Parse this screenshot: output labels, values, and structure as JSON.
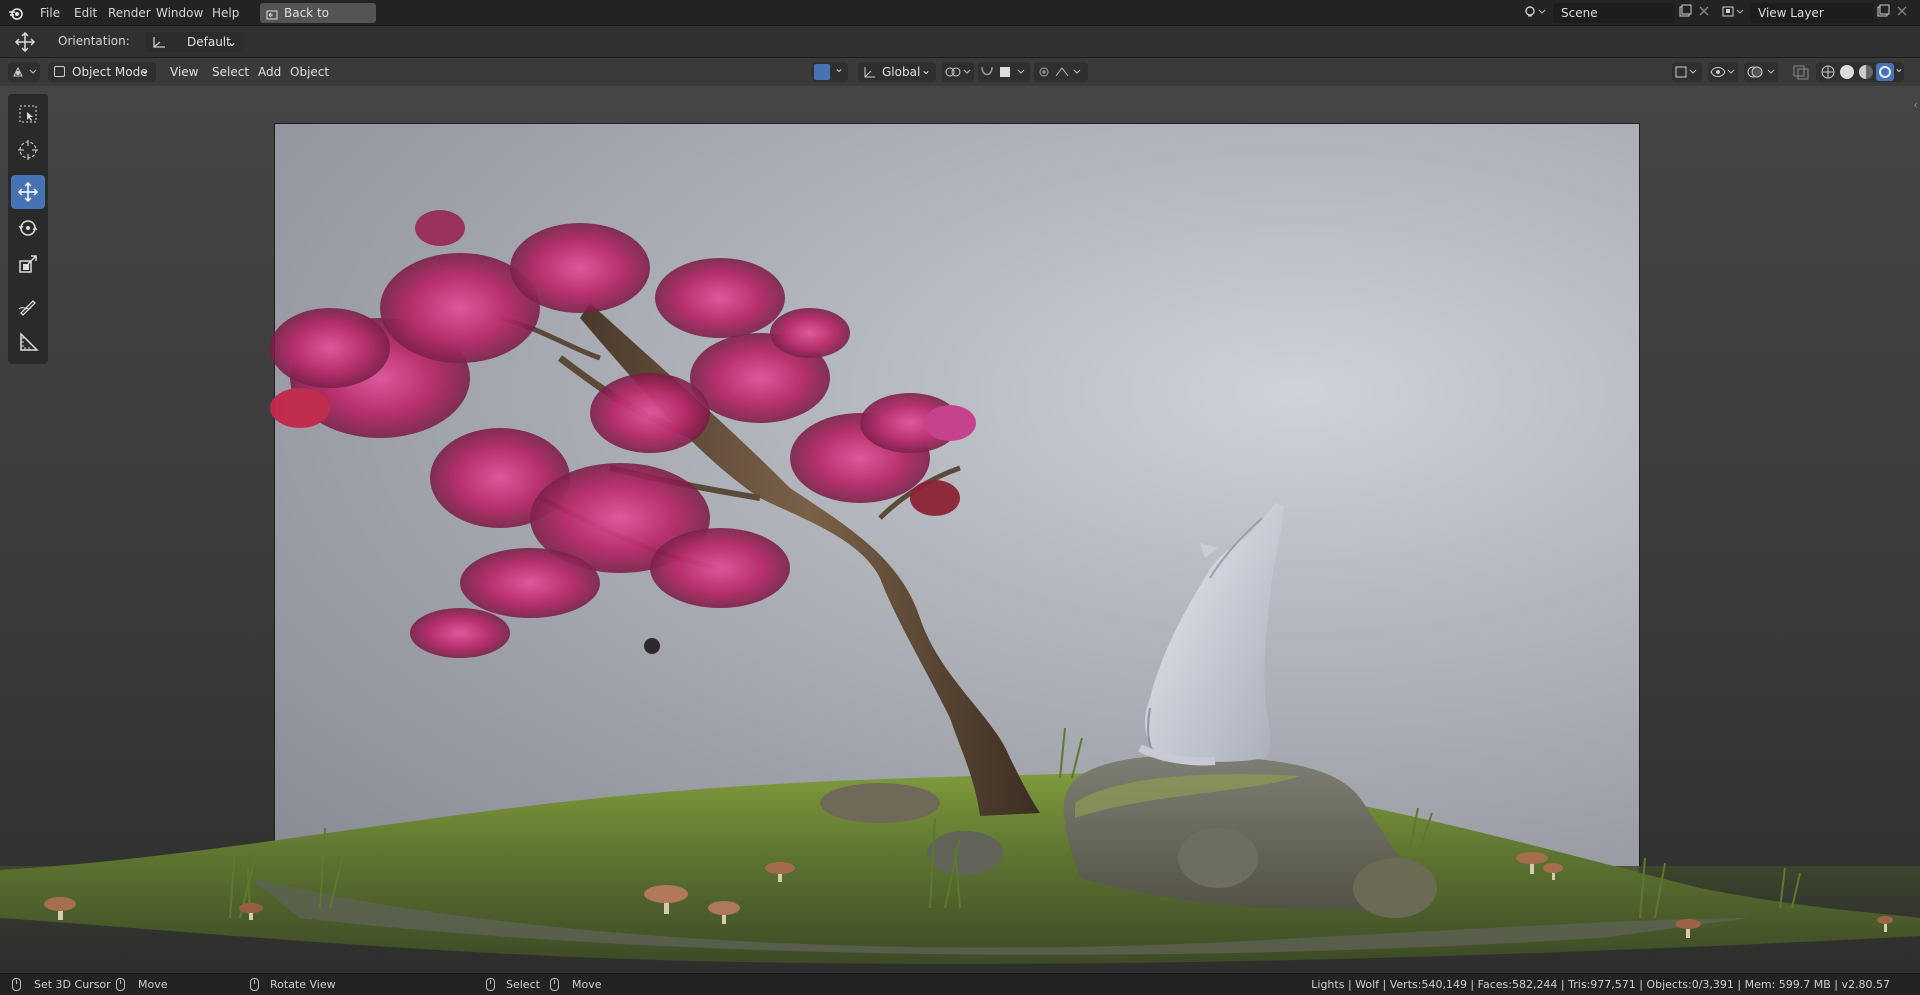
{
  "app": {
    "name": "Blender"
  },
  "topbar": {
    "menus": [
      "File",
      "Edit",
      "Render",
      "Window",
      "Help"
    ],
    "back_button": "Back to Previous",
    "scene_field": "Scene",
    "view_layer_field": "View Layer"
  },
  "tool_header": {
    "orientation_label": "Orientation:",
    "orientation_value": "Default"
  },
  "viewport_header": {
    "mode": "Object Mode",
    "menus": [
      "View",
      "Select",
      "Add",
      "Object"
    ],
    "transform_orientation": "Global"
  },
  "toolbar": {
    "tools": [
      "select-box",
      "cursor",
      "move",
      "rotate",
      "scale",
      "annotate",
      "measure"
    ],
    "active_tool": "move",
    "accent_color": "#4772b3"
  },
  "statusbar": {
    "hints": [
      "Set 3D Cursor",
      "Move",
      "Rotate View",
      "Select",
      "Move"
    ],
    "stats": "Lights | Wolf | Verts:540,149 | Faces:582,244 | Tris:977,571 | Objects:0/3,391 | Mem: 599.7 MB | v2.80.57"
  }
}
